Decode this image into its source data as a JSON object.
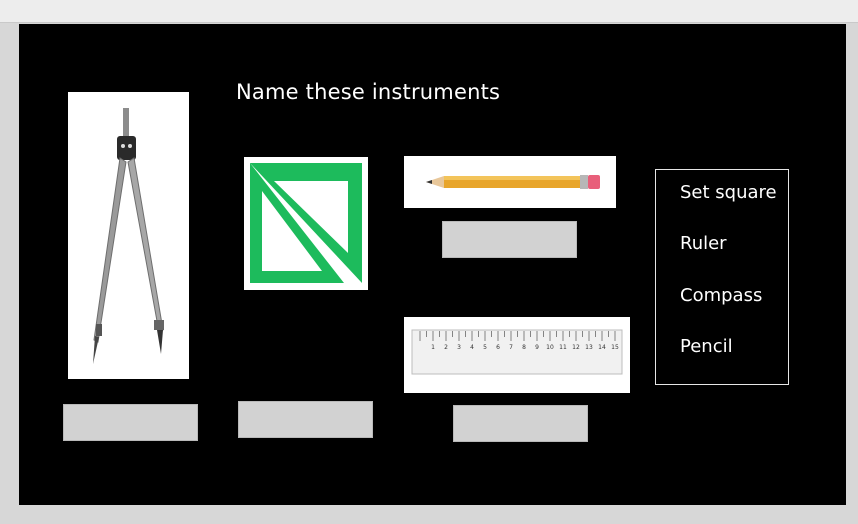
{
  "activity": {
    "title": "Name these instruments",
    "word_bank": [
      "Set square",
      "Ruler",
      "Compass",
      "Pencil"
    ]
  },
  "instruments": [
    {
      "icon": "compass-icon"
    },
    {
      "icon": "set-square-icon"
    },
    {
      "icon": "pencil-icon"
    },
    {
      "icon": "ruler-icon"
    }
  ],
  "ruler_ticks": [
    "1",
    "2",
    "3",
    "4",
    "5",
    "6",
    "7",
    "8",
    "9",
    "10",
    "11",
    "12",
    "13",
    "14",
    "15"
  ],
  "colors": {
    "stage_bg": "#000000",
    "set_square": "#1dbb5c",
    "pencil_body": "#e8a52a",
    "drop_zone": "#d2d2d2"
  }
}
